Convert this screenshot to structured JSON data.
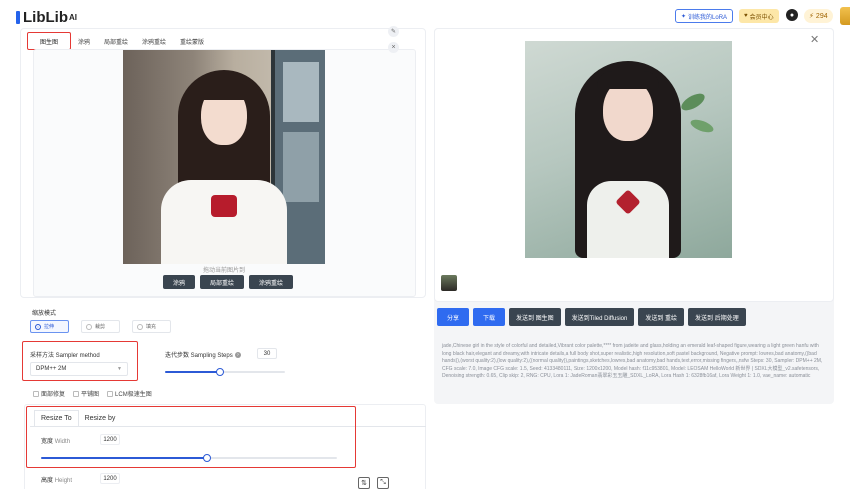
{
  "header": {
    "logo_text": "LibLib",
    "logo_sup": "AI",
    "train_lora_label": "训练我的LoRA",
    "member_label": "会员中心",
    "points_value": "294"
  },
  "left": {
    "tabs": [
      {
        "label": "图生图"
      },
      {
        "label": "涂鸦"
      },
      {
        "label": "局部重绘"
      },
      {
        "label": "涂鸦重绘"
      },
      {
        "label": "重绘蒙版"
      }
    ],
    "drop_hint": "拖动当前图片到",
    "action_buttons": [
      {
        "label": "涂鸦"
      },
      {
        "label": "局部重绘"
      },
      {
        "label": "涂鸦重绘"
      }
    ]
  },
  "scale_mode": {
    "label": "缩放模式",
    "options": [
      {
        "label": "拉伸",
        "selected": true
      },
      {
        "label": "裁剪",
        "selected": false
      },
      {
        "label": "填充",
        "selected": false
      }
    ]
  },
  "sampler": {
    "label": "采样方法 Sampler method",
    "value": "DPM++ 2M"
  },
  "steps": {
    "label": "迭代步数 Sampling Steps",
    "value": "30",
    "fraction": 0.46
  },
  "checks": [
    {
      "label": "面部修复"
    },
    {
      "label": "平铺图"
    },
    {
      "label": "LCM极速生图"
    }
  ],
  "resize": {
    "tabs": [
      {
        "label": "Resize To"
      },
      {
        "label": "Resize by"
      }
    ],
    "width_label_cn": "宽度",
    "width_label_en": "Width",
    "width_value": "1200",
    "width_fraction": 0.56,
    "height_label_cn": "高度",
    "height_label_en": "Height",
    "height_value": "1200"
  },
  "right": {
    "buttons": [
      {
        "label": "分享",
        "style": "blue"
      },
      {
        "label": "下载",
        "style": "blue"
      },
      {
        "label": "发送到 图生图",
        "style": "dark"
      },
      {
        "label": "发送到Tiled Diffusion",
        "style": "dark"
      },
      {
        "label": "发送到 重绘",
        "style": "dark"
      },
      {
        "label": "发送到 后期处理",
        "style": "dark"
      }
    ],
    "prompt": "jade,Chinese girl in the style of colorful and detailed,Vibrant color palette,**** from jadeite and glass,holding an emerald leaf-shaped figure,wearing a light green hanfu with long black hair,elegant and dreamy,with intricate details,a full body shot,super realistic,high resolution,soft pastel background, Negative prompt: lowres,bad anatomy,((bad hands)),(worst quality:2),(low quality:2),((normal quality)),paintings,sketches,lowres,bad anatomy,bad hands,text,error,missing fingers,,nsfw Steps: 30, Sampler: DPM++ 2M, CFG scale: 7.0, Image CFG scale: 1.5, Seed: 4133480111, Size: 1200x1200, Model hash: f11c953801, Model: LEOSAM HelloWorld 新世界 | SDXL大模型_v2.safetensors, Denoising strength: 0.65, Clip skip: 2, RNG: CPU, Lora 1: JadeRoman翡翠彩玉玉雕_SDXL_LoRA, Lora Hash 1: 6328fb16af, Lora Weight 1: 1.0, vae_name: automatic"
  },
  "colors": {
    "accent": "#2f6bf0",
    "highlight": "#e53935",
    "dark_button": "#3a4550"
  }
}
